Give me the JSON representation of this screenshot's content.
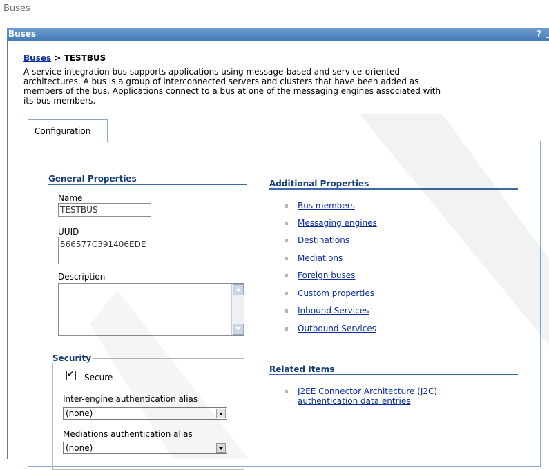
{
  "outer_title": "Buses",
  "titlebar": {
    "title": "Buses",
    "help_glyph": "?",
    "minimize_glyph": "_"
  },
  "breadcrumb": {
    "parent_link": "Buses",
    "separator": ">",
    "current": "TESTBUS"
  },
  "intro": {
    "line1": "A service integration bus supports applications using message-based and service-oriented",
    "line2": "architectures. A bus is a group of interconnected servers and clusters that have been added as",
    "line3": "members of the bus. Applications connect to a bus at one of the messaging engines associated with",
    "line4": "its bus members."
  },
  "tabs": [
    {
      "label": "Configuration",
      "active": true
    }
  ],
  "general": {
    "heading": "General Properties",
    "name_label": "Name",
    "name_value": "TESTBUS",
    "uuid_label": "UUID",
    "uuid_value": "566577C391406EDE",
    "description_label": "Description",
    "description_value": ""
  },
  "security": {
    "legend": "Security",
    "secure_label": "Secure",
    "secure_checked": true,
    "inter_engine_label": "Inter-engine authentication alias",
    "inter_engine_value": "(none)",
    "mediations_label": "Mediations authentication alias",
    "mediations_value": "(none)"
  },
  "additional": {
    "heading": "Additional Properties",
    "links": [
      "Bus members",
      "Messaging engines",
      "Destinations",
      "Mediations",
      "Foreign buses",
      "Custom properties",
      "Inbound Services",
      "Outbound Services"
    ]
  },
  "related": {
    "heading": "Related Items",
    "link_line1": "J2EE Connector Architecture (J2C)",
    "link_line2": "authentication data entries"
  },
  "colors": {
    "titlebar": "#4a7fbf",
    "link": "#0b2f9e",
    "section_heading": "#173d7a",
    "panel_border": "#8aa9c8"
  }
}
